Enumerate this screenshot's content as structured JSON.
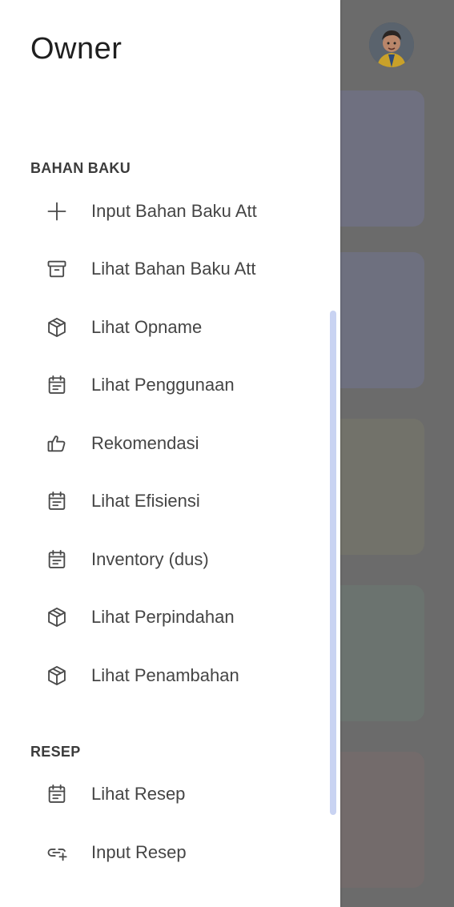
{
  "drawer": {
    "title": "Owner",
    "sections": [
      {
        "label": "BAHAN BAKU",
        "items": [
          {
            "label": "Input Bahan Baku Att",
            "icon": "plus-icon"
          },
          {
            "label": "Lihat Bahan Baku Att",
            "icon": "archive-icon"
          },
          {
            "label": "Lihat Opname",
            "icon": "cube-icon"
          },
          {
            "label": "Lihat Penggunaan",
            "icon": "calendar-list-icon"
          },
          {
            "label": "Rekomendasi",
            "icon": "thumbs-up-icon"
          },
          {
            "label": "Lihat Efisiensi",
            "icon": "calendar-list-icon"
          },
          {
            "label": "Inventory (dus)",
            "icon": "calendar-list-icon"
          },
          {
            "label": "Lihat Perpindahan",
            "icon": "cube-icon"
          },
          {
            "label": "Lihat Penambahan",
            "icon": "cube-icon"
          }
        ]
      },
      {
        "label": "RESEP",
        "items": [
          {
            "label": "Lihat Resep",
            "icon": "calendar-list-icon"
          },
          {
            "label": "Input Resep",
            "icon": "link-plus-icon"
          }
        ]
      }
    ]
  },
  "colors": {
    "drawer_bg": "#ffffff",
    "scrim": "#6b6b6b",
    "scrollbar": "#c9d3f2",
    "text_primary": "#1f1f1f",
    "text_item": "#454545"
  }
}
